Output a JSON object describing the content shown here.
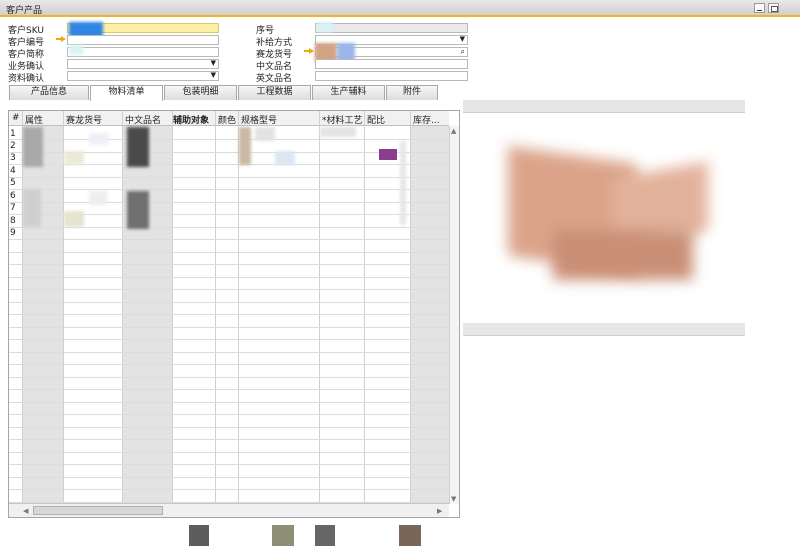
{
  "window": {
    "title": "客户产品"
  },
  "header": {
    "left_fields": [
      {
        "label": "客户SKU"
      },
      {
        "label": "客户编号"
      },
      {
        "label": "客户简称"
      },
      {
        "label": "业务确认"
      },
      {
        "label": "资料确认"
      }
    ],
    "right_fields": [
      {
        "label": "序号"
      },
      {
        "label": "补给方式"
      },
      {
        "label": "赛龙货号"
      },
      {
        "label": "中文品名"
      },
      {
        "label": "英文品名"
      }
    ]
  },
  "tabs": [
    {
      "label": "产品信息"
    },
    {
      "label": "物料清单"
    },
    {
      "label": "包装明细"
    },
    {
      "label": "工程数据"
    },
    {
      "label": "生产辅料"
    },
    {
      "label": "附件"
    }
  ],
  "grid": {
    "columns": [
      "#",
      "属性",
      "赛龙货号",
      "中文品名",
      "辅助对象",
      "颜色",
      "规格型号",
      "*材料工艺",
      "配比",
      "库存..."
    ],
    "row_numbers": [
      "1",
      "2",
      "3",
      "4",
      "5",
      "6",
      "7",
      "8",
      "9"
    ]
  },
  "colors": {
    "accent": "#f3b423",
    "required_field": "#fbf0a4",
    "purple_mark": "#8b3d8e",
    "product_copper": "#d79a7c"
  }
}
